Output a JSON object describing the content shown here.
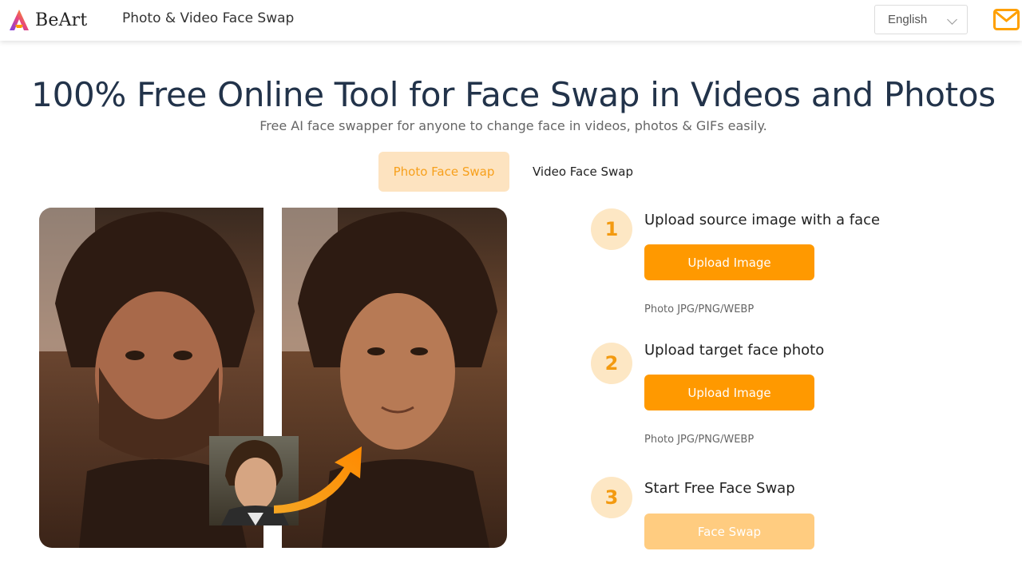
{
  "header": {
    "brand": "BeArt",
    "nav_title": "Photo & Video Face Swap",
    "language": "English"
  },
  "hero": {
    "title": "100% Free Online Tool for Face Swap in Videos and Photos",
    "subtitle": "Free AI face swapper for anyone to change face in videos, photos & GIFs easily."
  },
  "tabs": [
    {
      "label": "Photo Face Swap",
      "active": true
    },
    {
      "label": "Video Face Swap",
      "active": false
    }
  ],
  "steps": [
    {
      "number": "1",
      "title": "Upload source image with a face",
      "button": "Upload Image",
      "hint": "Photo JPG/PNG/WEBP"
    },
    {
      "number": "2",
      "title": "Upload target face photo",
      "button": "Upload Image",
      "hint": "Photo JPG/PNG/WEBP"
    },
    {
      "number": "3",
      "title": "Start Free Face Swap",
      "button": "Face Swap",
      "disabled": true
    }
  ],
  "colors": {
    "accent": "#ff9900",
    "accent_light": "#fde3c0",
    "title": "#22334a"
  },
  "icons": [
    "beart-logo-icon",
    "chevron-down-icon",
    "mail-icon",
    "curved-arrow-icon"
  ]
}
